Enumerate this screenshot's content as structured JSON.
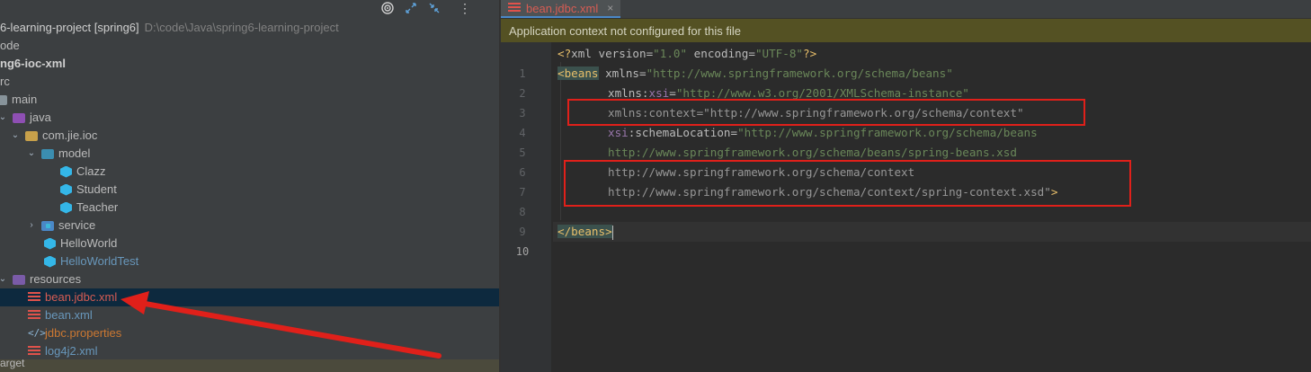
{
  "project": {
    "toolbar_icons": [
      "target-icon",
      "expand-icon",
      "collapse-icon",
      "more-icon"
    ],
    "root_label": "6-learning-project [spring6]",
    "root_path": "D:\\code\\Java\\spring6-learning-project",
    "items": [
      {
        "label": "ode"
      },
      {
        "label": "ng6-ioc-xml"
      },
      {
        "label": "rc"
      },
      {
        "label": "main"
      },
      {
        "label": "java"
      },
      {
        "label": "com.jie.ioc"
      },
      {
        "label": "model"
      },
      {
        "label": "Clazz"
      },
      {
        "label": "Student"
      },
      {
        "label": "Teacher"
      },
      {
        "label": "service"
      },
      {
        "label": "HelloWorld"
      },
      {
        "label": "HelloWorldTest"
      },
      {
        "label": "resources"
      },
      {
        "label": "bean.jdbc.xml"
      },
      {
        "label": "bean.xml"
      },
      {
        "label": "jdbc.properties"
      },
      {
        "label": "log4j2.xml"
      },
      {
        "label": "arget"
      }
    ]
  },
  "editor": {
    "tab": {
      "label": "bean.jdbc.xml",
      "close": "×"
    },
    "banner": "Application context not configured for this file",
    "line_numbers": [
      "1",
      "2",
      "3",
      "4",
      "5",
      "6",
      "7",
      "8",
      "9",
      "10"
    ],
    "lines": {
      "l1": {
        "a": "<?",
        "b": "xml version",
        "c": "=",
        "d": "\"1.0\"",
        "e": " encoding",
        "f": "=",
        "g": "\"UTF-8\"",
        "h": "?>"
      },
      "l2": {
        "a": "<beans",
        "b": " xmlns",
        "c": "=",
        "d": "\"http://www.springframework.org/schema/beans\""
      },
      "l3": {
        "a": "xmlns:",
        "b": "xsi",
        "c": "=",
        "d": "\"http://www.w3.org/2001/XMLSchema-instance\""
      },
      "l4": {
        "a": "xmlns:context",
        "b": "=",
        "c": "\"http://www.springframework.org/schema/context\""
      },
      "l5": {
        "a": "xsi",
        "b": ":schemaLocation",
        "c": "=",
        "d": "\"http://www.springframework.org/schema/beans"
      },
      "l6": {
        "a": "http://www.springframework.org/schema/beans/spring-beans.xsd"
      },
      "l7": {
        "a": "http://www.springframework.org/schema/context"
      },
      "l8": {
        "a": "http://www.springframework.org/schema/context/spring-context.xsd\"",
        "b": ">"
      },
      "l9": {},
      "l10": {
        "a": "</beans>"
      }
    }
  },
  "colors": {
    "annotation": "#e0201a",
    "banner_bg": "#545123",
    "selection_bg": "#0d293e"
  }
}
